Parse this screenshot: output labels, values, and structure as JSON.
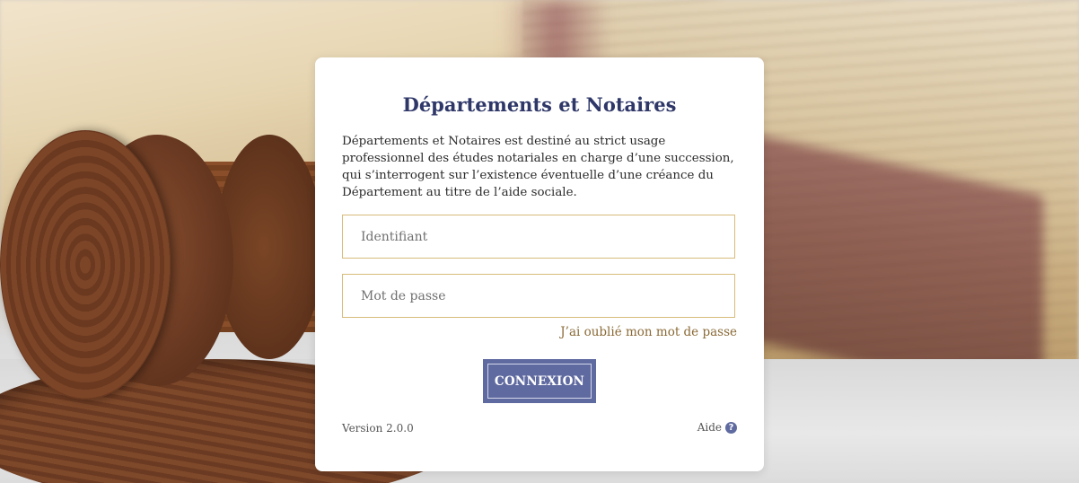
{
  "login": {
    "title": "Départements et Notaires",
    "description": "Départements et Notaires est destiné au strict usage professionnel des études notariales en charge d’une succession, qui s’interrogent sur l’existence éventuelle d’une créance du Département au titre de l’aide sociale.",
    "username": {
      "placeholder": "Identifiant",
      "value": ""
    },
    "password": {
      "placeholder": "Mot de passe",
      "value": ""
    },
    "forgot_link": "J’ai oublié mon mot de passe",
    "submit_label": "CONNEXION",
    "version": "Version 2.0.0",
    "help_label": "Aide",
    "help_icon": "question-circle-icon",
    "help_icon_glyph": "?"
  },
  "colors": {
    "title": "#2e3768",
    "button": "#5f6aa0",
    "field_border": "#d8bc7a",
    "link": "#8a6a36"
  }
}
